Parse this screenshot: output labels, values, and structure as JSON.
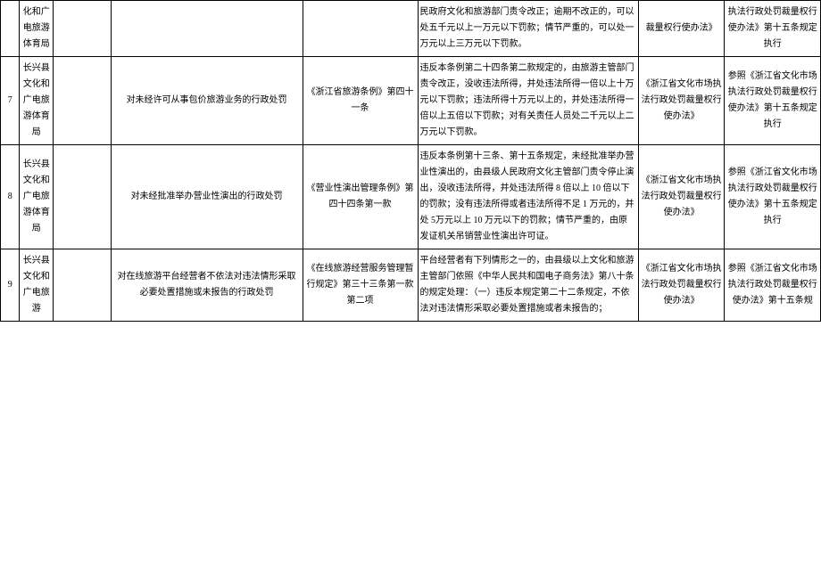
{
  "rows": [
    {
      "idx": "",
      "dept": "化和广电旅游体育局",
      "action": "",
      "basis": "",
      "detail": "民政府文化和旅游部门责令改正；逾期不改正的，可以处五千元以上一万元以下罚款；情节严重的，可以处一万元以上三万元以下罚款。",
      "ref": "裁量权行使办法》",
      "exec": "执法行政处罚裁量权行使办法》第十五条规定执行"
    },
    {
      "idx": "7",
      "dept": "长兴县文化和广电旅游体育局",
      "action": "对未经许可从事包价旅游业务的行政处罚",
      "basis": "《浙江省旅游条例》第四十一条",
      "detail": "违反本条例第二十四条第二款规定的，由旅游主管部门责令改正，没收违法所得，并处违法所得一倍以上十万元以下罚款；违法所得十万元以上的，并处违法所得一倍以上五倍以下罚款；对有关责任人员处二千元以上二万元以下罚款。",
      "ref": "《浙江省文化市场执法行政处罚裁量权行使办法》",
      "exec": "参照《浙江省文化市场执法行政处罚裁量权行使办法》第十五条规定执行"
    },
    {
      "idx": "8",
      "dept": "长兴县文化和广电旅游体育局",
      "action": "对未经批准举办营业性演出的行政处罚",
      "basis": "《营业性演出管理条例》第四十四条第一款",
      "detail": "违反本条例第十三条、第十五条规定，未经批准举办营业性演出的，由县级人民政府文化主管部门责令停止演出，没收违法所得，并处违法所得 8 倍以上 10 倍以下的罚款；没有违法所得或者违法所得不足 1 万元的，并处 5万元以上 10 万元以下的罚款；情节严重的，由原发证机关吊销营业性演出许可证。",
      "ref": "《浙江省文化市场执法行政处罚裁量权行使办法》",
      "exec": "参照《浙江省文化市场执法行政处罚裁量权行使办法》第十五条规定执行"
    },
    {
      "idx": "9",
      "dept": "长兴县文化和广电旅游",
      "action": "对在线旅游平台经营者不依法对违法情形采取必要处置措施或未报告的行政处罚",
      "basis": "《在线旅游经营服务管理暂行规定》第三十三条第一款第二项",
      "detail": "平台经营者有下列情形之一的，由县级以上文化和旅游主管部门依照《中华人民共和国电子商务法》第八十条的规定处理：（一）违反本规定第二十二条规定，不依法对违法情形采取必要处置措施或者未报告的；",
      "ref": "《浙江省文化市场执法行政处罚裁量权行使办法》",
      "exec": "参照《浙江省文化市场执法行政处罚裁量权行使办法》第十五条规"
    }
  ]
}
